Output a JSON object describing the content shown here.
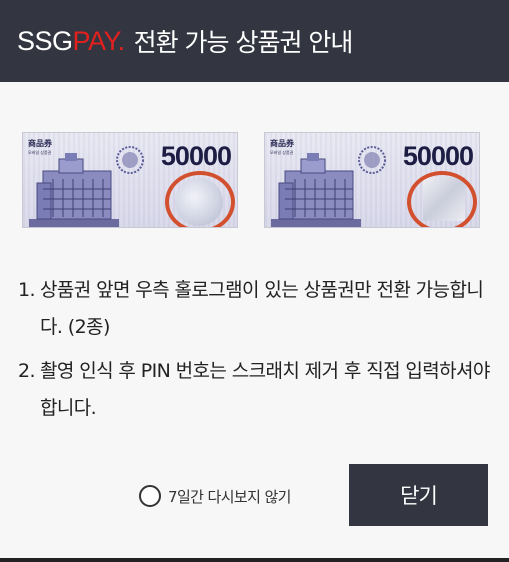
{
  "header": {
    "brand_ssg": "SSG",
    "brand_pay": "PAY.",
    "title": "전환 가능 상품권 안내"
  },
  "vouchers": [
    {
      "label": "商品券",
      "sub": "모바일 상품권",
      "amount": "50000",
      "holo": "round"
    },
    {
      "label": "商品券",
      "sub": "모바일 상품권",
      "amount": "50000",
      "holo": "square"
    }
  ],
  "instructions": [
    {
      "num": "1.",
      "text": "상품권 앞면 우측 홀로그램이 있는 상품권만 전환 가능합니다. (2종)"
    },
    {
      "num": "2.",
      "text": "촬영 인식 후 PIN 번호는 스크래치 제거 후 직접 입력하셔야 합니다."
    }
  ],
  "footer": {
    "checkbox_label": "7일간 다시보지 않기",
    "close_label": "닫기"
  },
  "colors": {
    "header_bg": "#333640",
    "brand_pay": "#e2201e",
    "highlight_circle": "#d3502f"
  }
}
